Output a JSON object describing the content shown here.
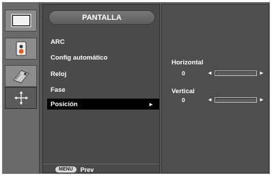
{
  "icons": [
    {
      "name": "picture-icon"
    },
    {
      "name": "audio-speaker-icon"
    },
    {
      "name": "tag-icon"
    },
    {
      "name": "position-cross-icon"
    }
  ],
  "menu": {
    "title": "PANTALLA",
    "items": [
      {
        "label": "ARC"
      },
      {
        "label": "Config automático"
      },
      {
        "label": "Reloj"
      },
      {
        "label": "Fase"
      },
      {
        "label": "Posición"
      }
    ],
    "selected_index": 4,
    "selected_arrow": "►"
  },
  "adjust": {
    "horizontal": {
      "label": "Horizontal",
      "value": "0",
      "level": 0
    },
    "vertical": {
      "label": "Vertical",
      "value": "0",
      "level": 0
    },
    "left_arrow": "◄",
    "right_arrow": "►"
  },
  "footer": {
    "button_label": "MENU",
    "action_label": "Prev"
  }
}
